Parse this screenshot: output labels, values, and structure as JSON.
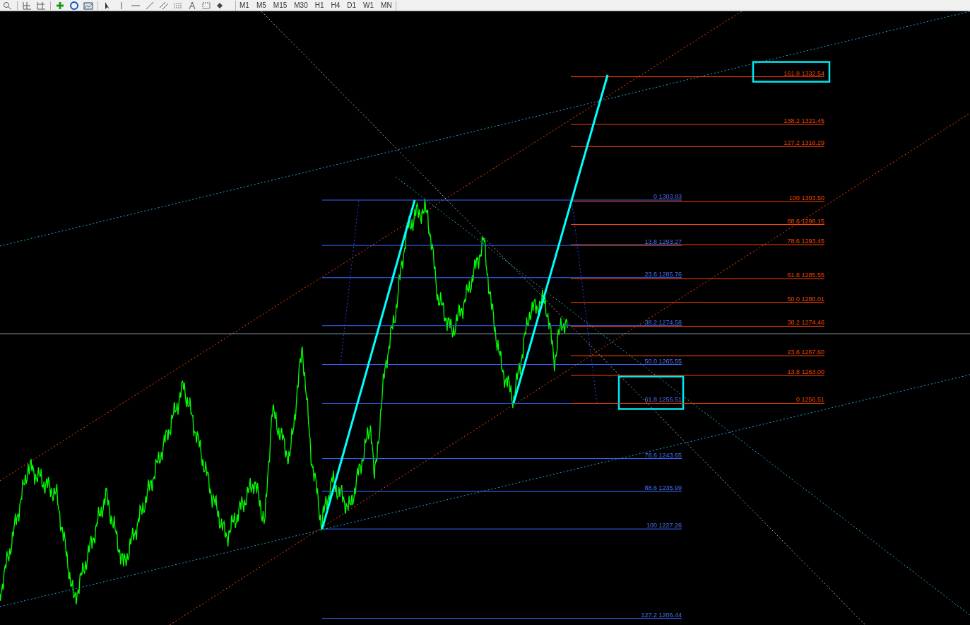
{
  "toolbar": {
    "timeframes": [
      "M1",
      "M5",
      "M15",
      "M30",
      "H1",
      "H4",
      "D1",
      "W1",
      "MN"
    ]
  },
  "fibo_retracement": {
    "levels": [
      {
        "ratio": "0",
        "price": "1303.83",
        "highlighted": false
      },
      {
        "ratio": "13.8",
        "price": "1293.27",
        "highlighted": false
      },
      {
        "ratio": "23.6",
        "price": "1285.76",
        "highlighted": false
      },
      {
        "ratio": "38.2",
        "price": "1274.58",
        "highlighted": false
      },
      {
        "ratio": "50.0",
        "price": "1265.55",
        "highlighted": false
      },
      {
        "ratio": "61.8",
        "price": "1256.51",
        "highlighted": true
      },
      {
        "ratio": "78.6",
        "price": "1243.65",
        "highlighted": false
      },
      {
        "ratio": "88.6",
        "price": "1235.99",
        "highlighted": false
      },
      {
        "ratio": "100",
        "price": "1227.26",
        "highlighted": false
      },
      {
        "ratio": "127.2",
        "price": "1206.44",
        "highlighted": false
      }
    ]
  },
  "fibo_expansion": {
    "levels": [
      {
        "ratio": "161.8",
        "price": "1332.54",
        "highlighted": true
      },
      {
        "ratio": "138.2",
        "price": "1321.45",
        "highlighted": false
      },
      {
        "ratio": "127.2",
        "price": "1316.29",
        "highlighted": false
      },
      {
        "ratio": "100",
        "price": "1303.50",
        "highlighted": false
      },
      {
        "ratio": "88.6",
        "price": "1298.15",
        "highlighted": false
      },
      {
        "ratio": "78.6",
        "price": "1293.45",
        "highlighted": false
      },
      {
        "ratio": "61.8",
        "price": "1285.55",
        "highlighted": false
      },
      {
        "ratio": "50.0",
        "price": "1280.01",
        "highlighted": false
      },
      {
        "ratio": "38.2",
        "price": "1274.46",
        "highlighted": false
      },
      {
        "ratio": "23.6",
        "price": "1267.60",
        "highlighted": false
      },
      {
        "ratio": "13.8",
        "price": "1263.00",
        "highlighted": false
      },
      {
        "ratio": "0",
        "price": "1256.51",
        "highlighted": false
      }
    ]
  }
}
